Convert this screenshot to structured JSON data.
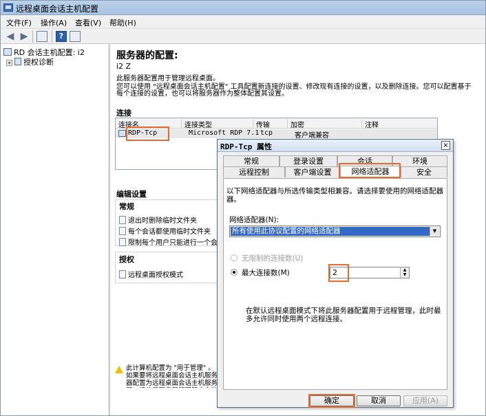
{
  "window": {
    "title": "远程桌面会话主机配置"
  },
  "menu": [
    "文件(F)",
    "操作(A)",
    "查看(V)",
    "帮助(H)"
  ],
  "toolbar": {
    "back_icon": "back-arrow-icon",
    "forward_icon": "forward-arrow-icon",
    "help_label": "?"
  },
  "tree": {
    "root_label": "RD 会话主机配置: i2",
    "child_label": "授权诊断",
    "expander": "+"
  },
  "main": {
    "heading": "服务器的配置:",
    "server_name": "i2               Z",
    "desc_line1": "此服务器配置用于管理远程桌面。",
    "desc_line2": "您可以使用 \"远程桌面会话主机配置\" 工具配置新连接的设置、修改现有连接的设置，以及删除连接。您可以配置基于",
    "desc_line3": "每个连接的设置，也可以将服务器作为整体配置其设置。",
    "connections_title": "连接",
    "columns": [
      "连接名",
      "连接类型",
      "传输",
      "加密",
      "注释"
    ],
    "row": {
      "name": "RDP-Tcp",
      "type": "Microsoft RDP 7.1",
      "transport": "tcp",
      "encryption": "客户端兼容",
      "comment": ""
    },
    "edit_title": "编辑设置",
    "general_title": "常规",
    "general_items": [
      "退出时删除临时文件夹",
      "每个会话都使用临时文件夹",
      "限制每个用户只能进行一个会话"
    ],
    "licensing_title": "授权",
    "licensing_items": [
      "远程桌面授权模式"
    ],
    "warning_text": "此计算机配置为 \"用于管理\" 。如果要将远程桌面会话主机服务器配置为远程桌面会话主机服务器，请使用服务器管理器来安装远程桌面会话主机"
  },
  "dialog": {
    "title": "RDP-Tcp 属性",
    "close": "×",
    "tabs_row1": [
      "常规",
      "登录设置",
      "会话",
      "环境"
    ],
    "tabs_row2": [
      "远程控制",
      "客户端设置",
      "网络适配器",
      "安全"
    ],
    "intro_line1": "以下网络适配器与所选传输类型相兼容。请选择要使用的网络适配器",
    "intro_line2": "器。",
    "adapter_label": "网络适配器(N):",
    "adapter_value": "所有使用此协议配置的网络适配器",
    "unlimited_label": "无限制的连接数(U)",
    "max_label": "最大连接数(M)",
    "max_value": "2",
    "note_line1": "在默认远程桌面模式下将此服务器配置用于远程管理，此时最",
    "note_line2": "多允许同时使用两个远程连接。",
    "ok": "确定",
    "cancel": "取消",
    "apply": "应用(A)"
  }
}
